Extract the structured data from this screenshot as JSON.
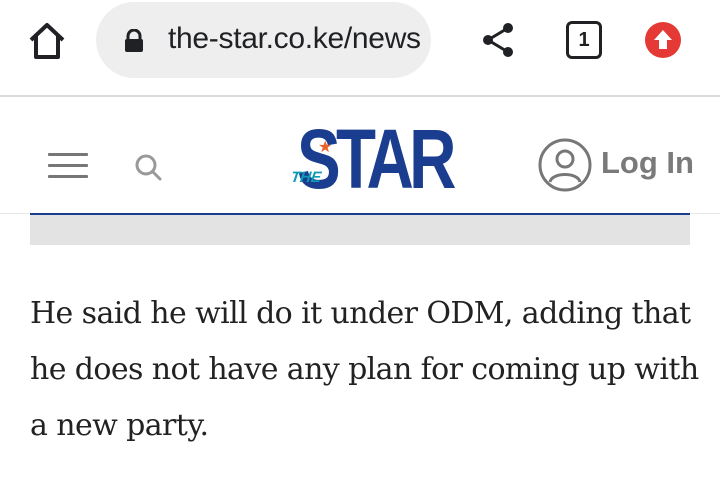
{
  "browser": {
    "url": "the-star.co.ke/news",
    "tab_count": "1",
    "icons": {
      "home": "home-icon",
      "lock": "lock-icon",
      "share": "share-icon",
      "update": "arrow-up-circle-icon"
    },
    "update_color": "#e53935"
  },
  "site_header": {
    "logo_small": "THE",
    "logo_main": "STAR",
    "login_label": "Log In",
    "brand_color": "#1a3d8f",
    "accent_color": "#0d9bb5",
    "icons": {
      "menu": "hamburger-menu-icon",
      "search": "search-icon",
      "account": "user-avatar-icon"
    }
  },
  "article": {
    "paragraph": "He said he will do it under ODM, adding that he does not have any plan for coming up with a new party."
  }
}
